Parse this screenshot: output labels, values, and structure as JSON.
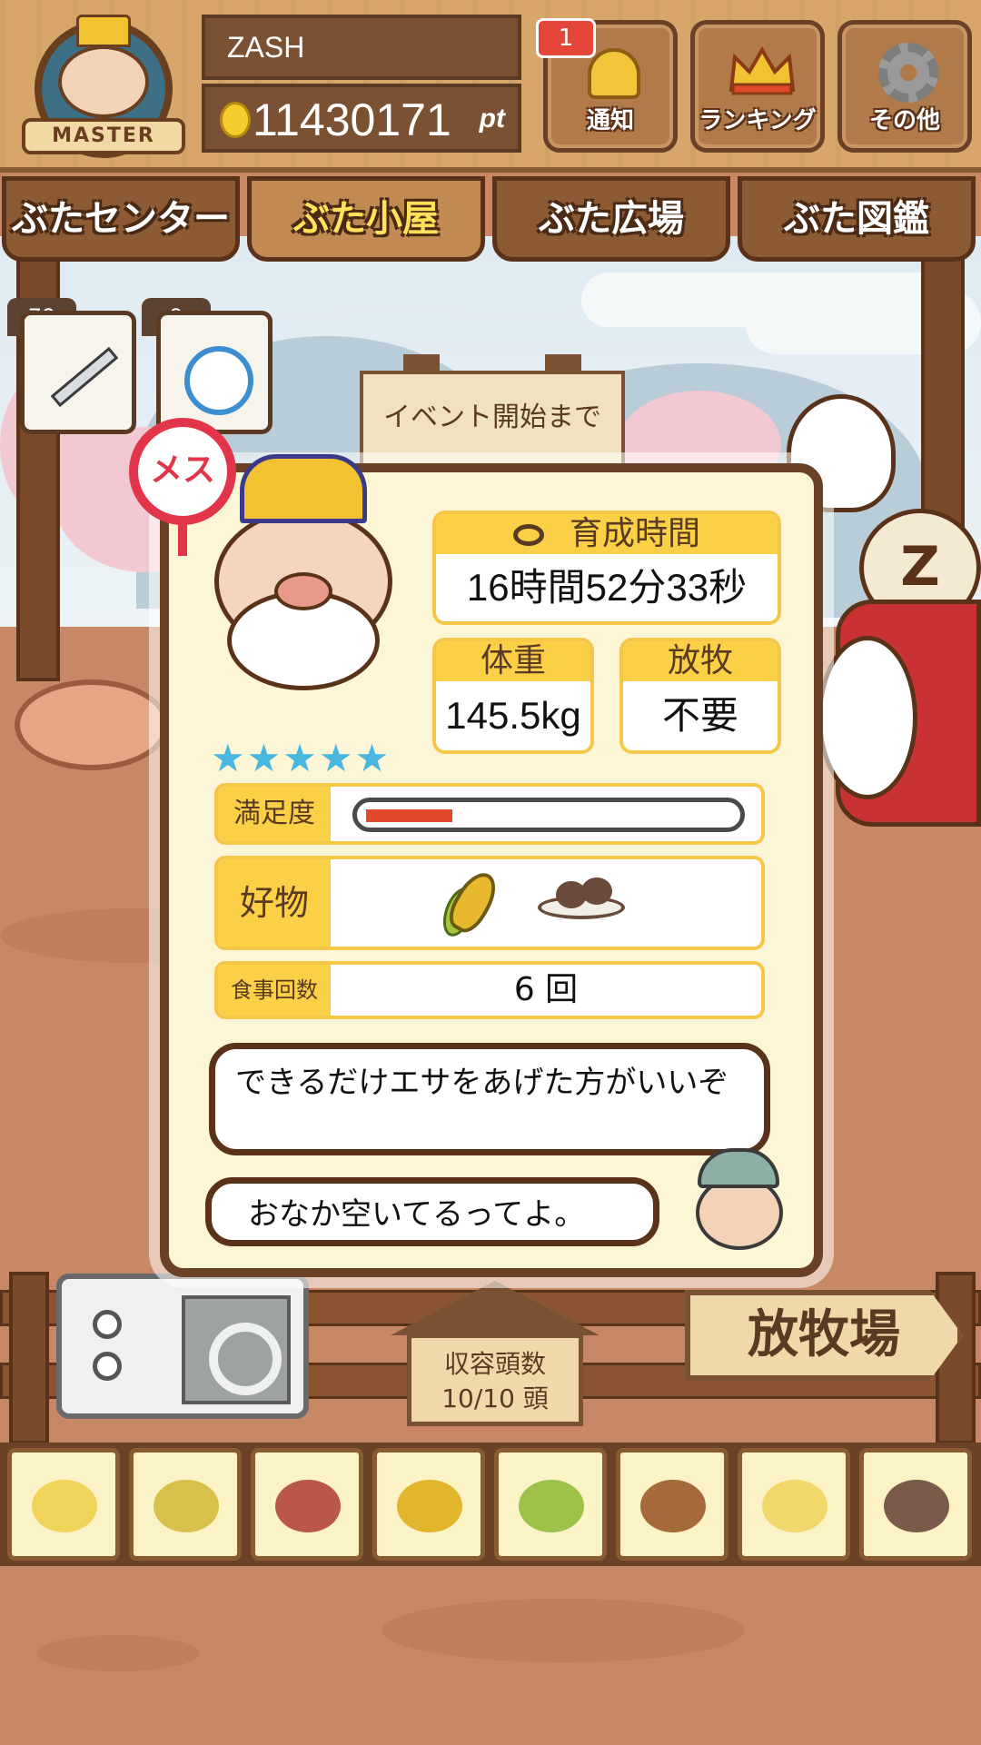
{
  "user": {
    "rank_badge": "MASTER",
    "name": "ZASH",
    "points": "11430171",
    "points_unit": "pt"
  },
  "header_buttons": {
    "notify_label": "通知",
    "notify_count": "1",
    "ranking_label": "ランキング",
    "other_label": "その他"
  },
  "tabs": [
    {
      "label": "ぶたセンター",
      "active": false
    },
    {
      "label": "ぶた小屋",
      "active": true
    },
    {
      "label": "ぶた広場",
      "active": false
    },
    {
      "label": "ぶた図鑑",
      "active": false
    }
  ],
  "items": {
    "syringe_count": "79",
    "stopwatch_count": "9"
  },
  "event_sign": "イベント開始まで",
  "pig_info": {
    "gender": "メス",
    "rarity_stars": "★★★★★",
    "rarity_level": 5,
    "growth_time_label": "育成時間",
    "growth_time_value": "16時間52分33秒",
    "weight_label": "体重",
    "weight_value": "145.5kg",
    "grazing_label": "放牧",
    "grazing_value": "不要",
    "satisfaction_label": "満足度",
    "satisfaction_level": 0.23,
    "favorite_label": "好物",
    "favorite_foods": [
      "corn-icon",
      "dumpling-plate-icon"
    ],
    "meal_count_label": "食事回数",
    "meal_count_value": "6 回",
    "advice_message": "できるだけエサをあげた方がいいぞ",
    "status_message": "おなか空いてるってよ。"
  },
  "pen": {
    "capacity_label": "収容頭数",
    "capacity_value": "10/10 頭",
    "pasture_sign": "放牧場"
  },
  "food_tray": [
    "yellow-grain-icon",
    "mixed-grain-icon",
    "sweet-potato-icon",
    "corn-icon",
    "soybean-icon",
    "acorn-icon",
    "grain-bowl-icon",
    "dumpling-plate-icon"
  ],
  "colors": {
    "accent_yellow": "#fbd046",
    "frame_brown": "#6a4126",
    "female_red": "#e3354a",
    "star_blue": "#49b6df",
    "satisfaction_bar": "#e04a2a"
  }
}
